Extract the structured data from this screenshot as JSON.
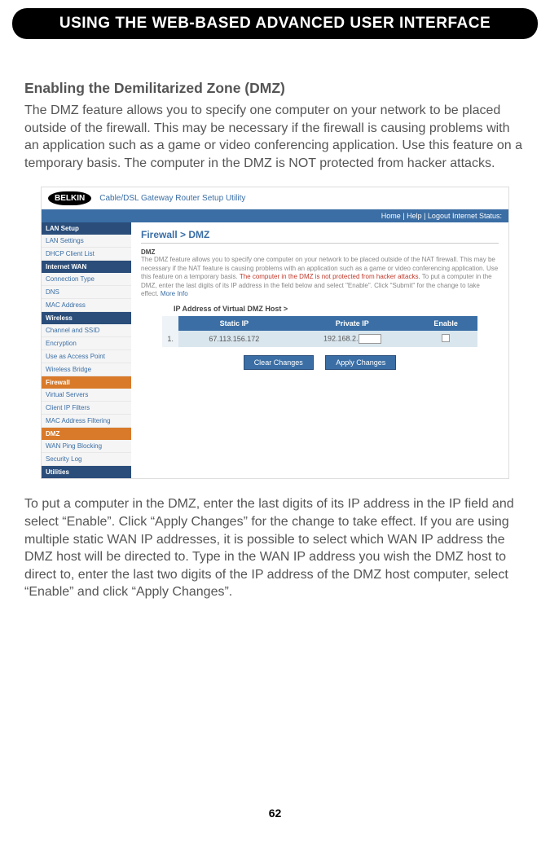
{
  "header_title": "USING THE WEB-BASED ADVANCED USER INTERFACE",
  "subheading": "Enabling the Demilitarized Zone (DMZ)",
  "para1": "The DMZ feature allows you to specify one computer on your network to be placed outside of the firewall. This may be necessary if the firewall is causing problems with an application such as a game or video conferencing application. Use this feature on a temporary basis. The computer in the DMZ is NOT protected from hacker attacks.",
  "para2": "To put a computer in the DMZ, enter the last digits of its IP address in the IP field and select “Enable”. Click “Apply Changes” for the change to take effect. If you are using multiple static WAN IP addresses, it is possible to select which WAN IP address the DMZ host will be directed to. Type in the WAN IP address you wish the DMZ host to direct to, enter the last two digits of the IP address of the DMZ host computer, select “Enable” and click “Apply Changes”.",
  "page_number": "62",
  "screenshot": {
    "logo": "BELKIN",
    "utility_title": "Cable/DSL Gateway Router Setup Utility",
    "navbar": "Home | Help | Logout    Internet Status:",
    "sidebar": {
      "cat1": "LAN Setup",
      "items1": [
        "LAN Settings",
        "DHCP Client List"
      ],
      "cat2": "Internet WAN",
      "items2": [
        "Connection Type",
        "DNS",
        "MAC Address"
      ],
      "cat3": "Wireless",
      "items3": [
        "Channel and SSID",
        "Encryption",
        "Use as Access Point",
        "Wireless Bridge"
      ],
      "cat4": "Firewall",
      "items4": [
        "Virtual Servers",
        "Client IP Filters",
        "MAC Address Filtering"
      ],
      "cat5": "DMZ",
      "items5": [
        "WAN Ping Blocking",
        "Security Log"
      ],
      "cat6": "Utilities"
    },
    "breadcrumb": "Firewall > DMZ",
    "dmz_label": "DMZ",
    "desc_plain": "The DMZ feature allows you to specify one computer on your network to be placed outside of the NAT firewall. This may be necessary if the NAT feature is causing problems with an application such as a game or video conferencing application. Use this feature on a temporary basis. ",
    "desc_warn": "The computer in the DMZ is not protected from hacker attacks. ",
    "desc_rest": "To put a computer in the DMZ, enter the last digits of its IP address in the field below and select \"Enable\". Click \"Submit\" for the change to take effect. ",
    "desc_link": "More Info",
    "field_label": "IP Address of Virtual DMZ Host >",
    "table": {
      "headers": [
        "Static IP",
        "Private IP",
        "Enable"
      ],
      "row_num": "1.",
      "static_ip": "67.113.156.172",
      "private_prefix": "192.168.2."
    },
    "btn_clear": "Clear Changes",
    "btn_apply": "Apply Changes"
  }
}
